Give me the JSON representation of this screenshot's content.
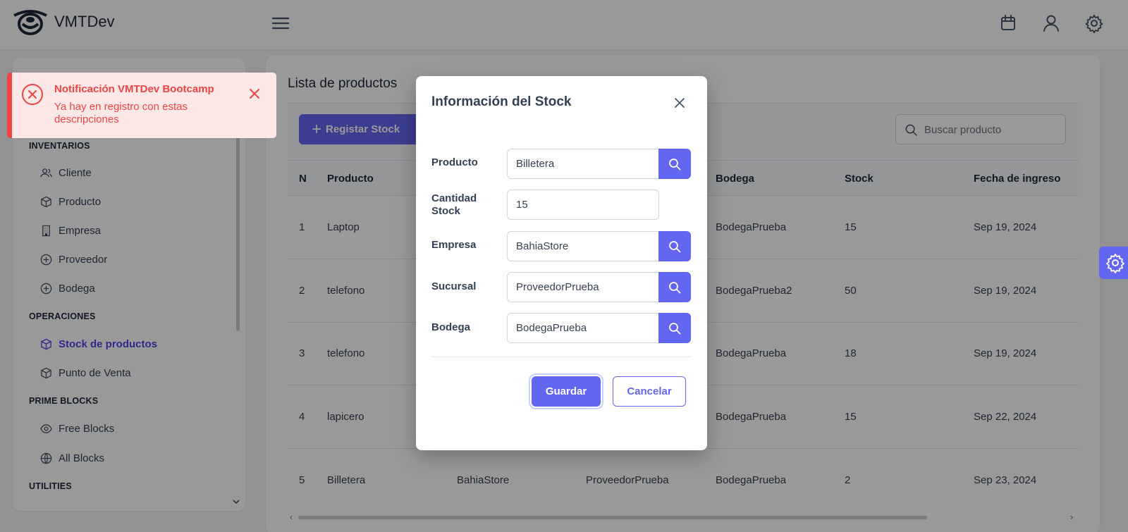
{
  "app": {
    "brand": "VMTDev"
  },
  "sidebar": {
    "sections": [
      {
        "label": "INVENTARIOS"
      },
      {
        "label": "OPERACIONES"
      },
      {
        "label": "PRIME BLOCKS"
      },
      {
        "label": "UTILITIES"
      }
    ],
    "items": [
      {
        "label": "Cliente",
        "icon": "users-icon"
      },
      {
        "label": "Producto",
        "icon": "box-icon"
      },
      {
        "label": "Empresa",
        "icon": "building-icon"
      },
      {
        "label": "Proveedor",
        "icon": "plus-circle-icon"
      },
      {
        "label": "Bodega",
        "icon": "plus-circle-icon"
      },
      {
        "label": "Stock de productos",
        "icon": "box-icon",
        "active": true
      },
      {
        "label": "Punto de Venta",
        "icon": "box-icon"
      },
      {
        "label": "Free Blocks",
        "icon": "eye-icon"
      },
      {
        "label": "All Blocks",
        "icon": "globe-icon"
      }
    ]
  },
  "main": {
    "title": "Lista de productos",
    "new_button": "Registar Stock",
    "search_placeholder": "Buscar producto",
    "columns": [
      "N",
      "Producto",
      "Bodega",
      "Stock",
      "Fecha de ingreso"
    ],
    "rows": [
      {
        "n": "1",
        "producto": "Laptop",
        "empresa": "",
        "sucursal": "",
        "bodega": "BodegaPrueba",
        "stock": "15",
        "fecha": "Sep 19, 2024"
      },
      {
        "n": "2",
        "producto": "telefono",
        "empresa": "",
        "sucursal": "",
        "bodega": "BodegaPrueba2",
        "stock": "50",
        "fecha": "Sep 19, 2024"
      },
      {
        "n": "3",
        "producto": "telefono",
        "empresa": "",
        "sucursal": "",
        "bodega": "BodegaPrueba",
        "stock": "18",
        "fecha": "Sep 19, 2024"
      },
      {
        "n": "4",
        "producto": "lapicero",
        "empresa": "",
        "sucursal": "",
        "bodega": "BodegaPrueba",
        "stock": "15",
        "fecha": "Sep 22, 2024"
      },
      {
        "n": "5",
        "producto": "Billetera",
        "empresa": "BahiaStore",
        "sucursal": "ProveedorPrueba",
        "bodega": "BodegaPrueba",
        "stock": "2",
        "fecha": "Sep 23, 2024"
      }
    ]
  },
  "toast": {
    "title": "Notificación VMTDev Bootcamp",
    "message": "Ya hay en registro con estas descripciones",
    "color": "#ef4444"
  },
  "dialog": {
    "title": "Información del Stock",
    "fields": [
      {
        "label": "Producto",
        "value": "Billetera"
      },
      {
        "label": "Cantidad Stock",
        "value": "15"
      },
      {
        "label": "Empresa",
        "value": "BahiaStore"
      },
      {
        "label": "Sucursal",
        "value": "ProveedorPrueba"
      },
      {
        "label": "Bodega",
        "value": "BodegaPrueba"
      }
    ],
    "save": "Guardar",
    "cancel": "Cancelar"
  },
  "colors": {
    "accent": "#6366f1",
    "error": "#ef4444"
  }
}
